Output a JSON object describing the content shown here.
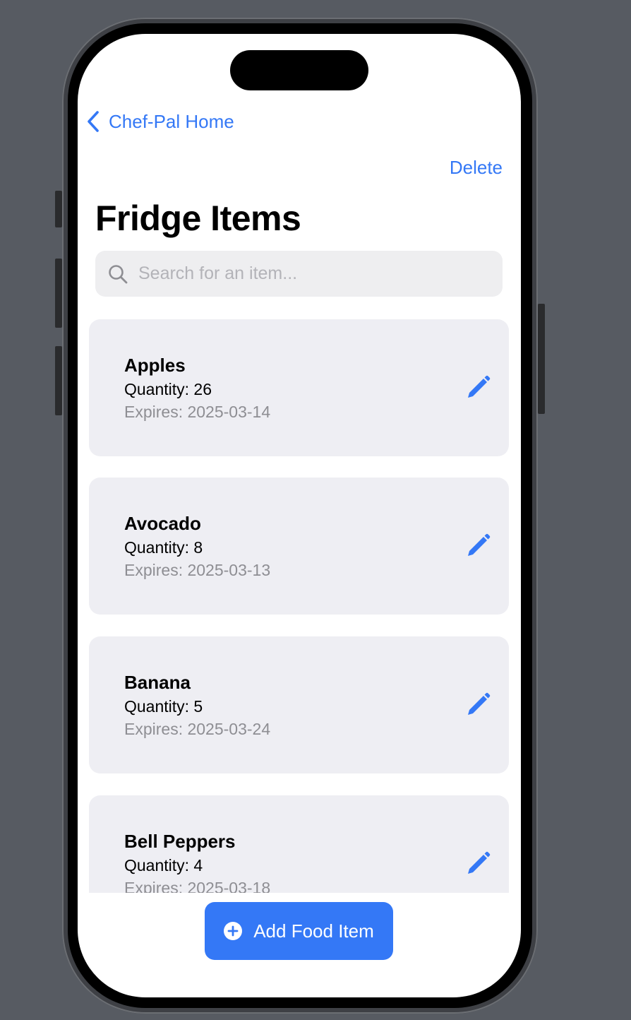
{
  "navigation": {
    "back_label": "Chef-Pal Home",
    "delete_label": "Delete"
  },
  "page": {
    "title": "Fridge Items"
  },
  "search": {
    "placeholder": "Search for an item...",
    "value": ""
  },
  "items": [
    {
      "name": "Apples",
      "quantity": "Quantity: 26",
      "expires": "Expires: 2025-03-14"
    },
    {
      "name": "Avocado",
      "quantity": "Quantity: 8",
      "expires": "Expires: 2025-03-13"
    },
    {
      "name": "Banana",
      "quantity": "Quantity: 5",
      "expires": "Expires: 2025-03-24"
    },
    {
      "name": "Bell Peppers",
      "quantity": "Quantity: 4",
      "expires": "Expires: 2025-03-18"
    }
  ],
  "actions": {
    "add_label": "Add Food Item"
  },
  "icons": {
    "back": "chevron-left-icon",
    "search": "search-icon",
    "edit": "pencil-icon",
    "add": "plus-circle-icon"
  },
  "colors": {
    "accent": "#3478f6",
    "card_background": "#eeeef3",
    "secondary_text": "#8e8e93",
    "device_background": "#575b62"
  }
}
